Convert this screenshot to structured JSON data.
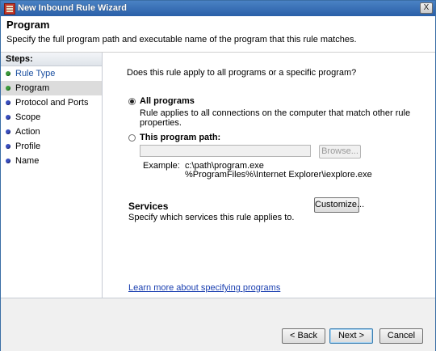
{
  "window": {
    "title": "New Inbound Rule Wizard",
    "close_glyph": "X"
  },
  "header": {
    "title": "Program",
    "description": "Specify the full program path and executable name of the program that this rule matches."
  },
  "steps": {
    "heading": "Steps:",
    "items": [
      {
        "label": "Rule Type",
        "state": "done"
      },
      {
        "label": "Program",
        "state": "active"
      },
      {
        "label": "Protocol and Ports",
        "state": "pending"
      },
      {
        "label": "Scope",
        "state": "pending"
      },
      {
        "label": "Action",
        "state": "pending"
      },
      {
        "label": "Profile",
        "state": "pending"
      },
      {
        "label": "Name",
        "state": "pending"
      }
    ]
  },
  "main": {
    "question": "Does this rule apply to all programs or a specific program?",
    "all_programs": {
      "label": "All programs",
      "description_line1": "Rule applies to all connections on the computer that match other rule",
      "description_line2": "properties.",
      "selected": true
    },
    "program_path": {
      "label": "This program path:",
      "value": "",
      "selected": false,
      "browse_label": "Browse...",
      "example_label": "Example:",
      "example_line1": "c:\\path\\program.exe",
      "example_line2": "%ProgramFiles%\\Internet Explorer\\iexplore.exe"
    },
    "services": {
      "title": "Services",
      "description": "Specify which services this rule applies to.",
      "customize_label": "Customize..."
    },
    "learn_more": "Learn more about specifying programs"
  },
  "footer": {
    "back_label": "< Back",
    "next_label": "Next >",
    "cancel_label": "Cancel"
  }
}
